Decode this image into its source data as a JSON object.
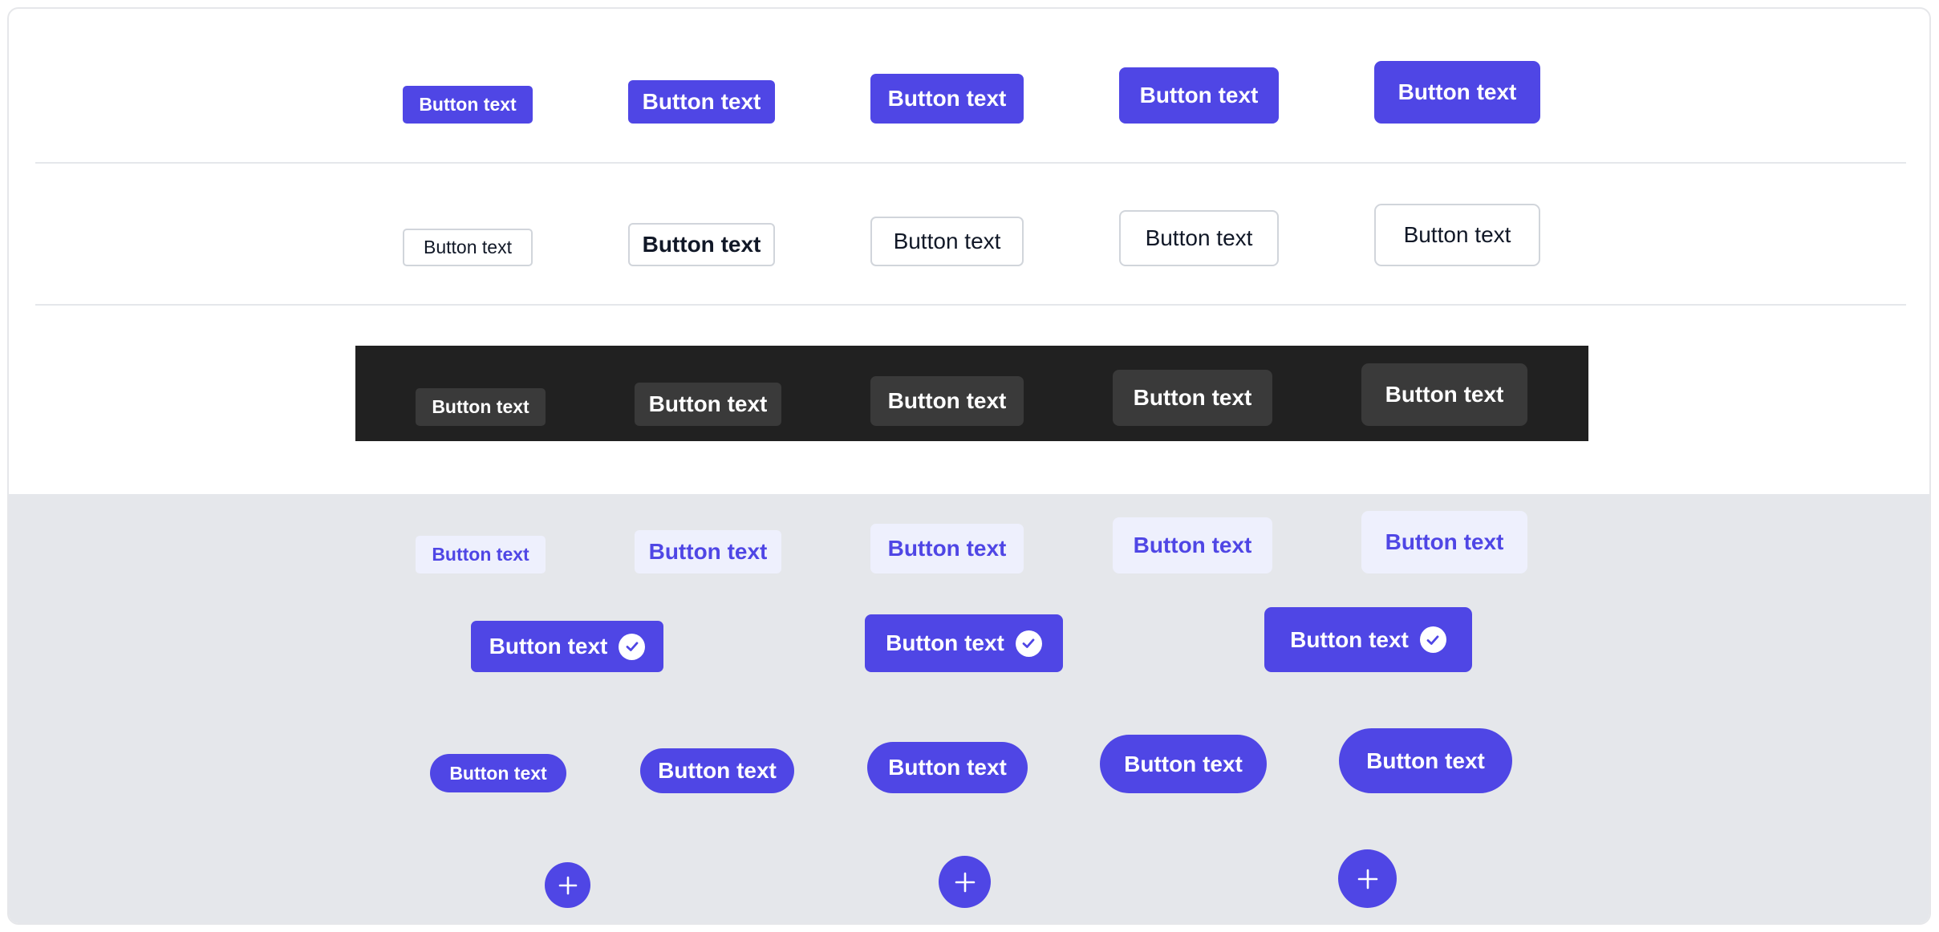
{
  "colors": {
    "primary": "#4f46e5",
    "secondary_bg": "#ffffff",
    "dark_band": "#212121",
    "dark_button": "#3a3a3a",
    "soft_bg": "#eef0fd",
    "soft_text": "#4f46e5",
    "gray_area": "#e5e7eb"
  },
  "primary_row": [
    "Button text",
    "Button text",
    "Button text",
    "Button text",
    "Button text"
  ],
  "secondary_row": [
    "Button text",
    "Button text",
    "Button text",
    "Button text",
    "Button text"
  ],
  "dark_row": [
    "Button text",
    "Button text",
    "Button text",
    "Button text",
    "Button text"
  ],
  "soft_row": [
    "Button text",
    "Button text",
    "Button text",
    "Button text",
    "Button text"
  ],
  "icon_row": [
    "Button text",
    "Button text",
    "Button text"
  ],
  "rounded_row": [
    "Button text",
    "Button text",
    "Button text",
    "Button text",
    "Button text"
  ],
  "icons": {
    "check": "check-circle-icon",
    "plus": "plus-icon"
  }
}
